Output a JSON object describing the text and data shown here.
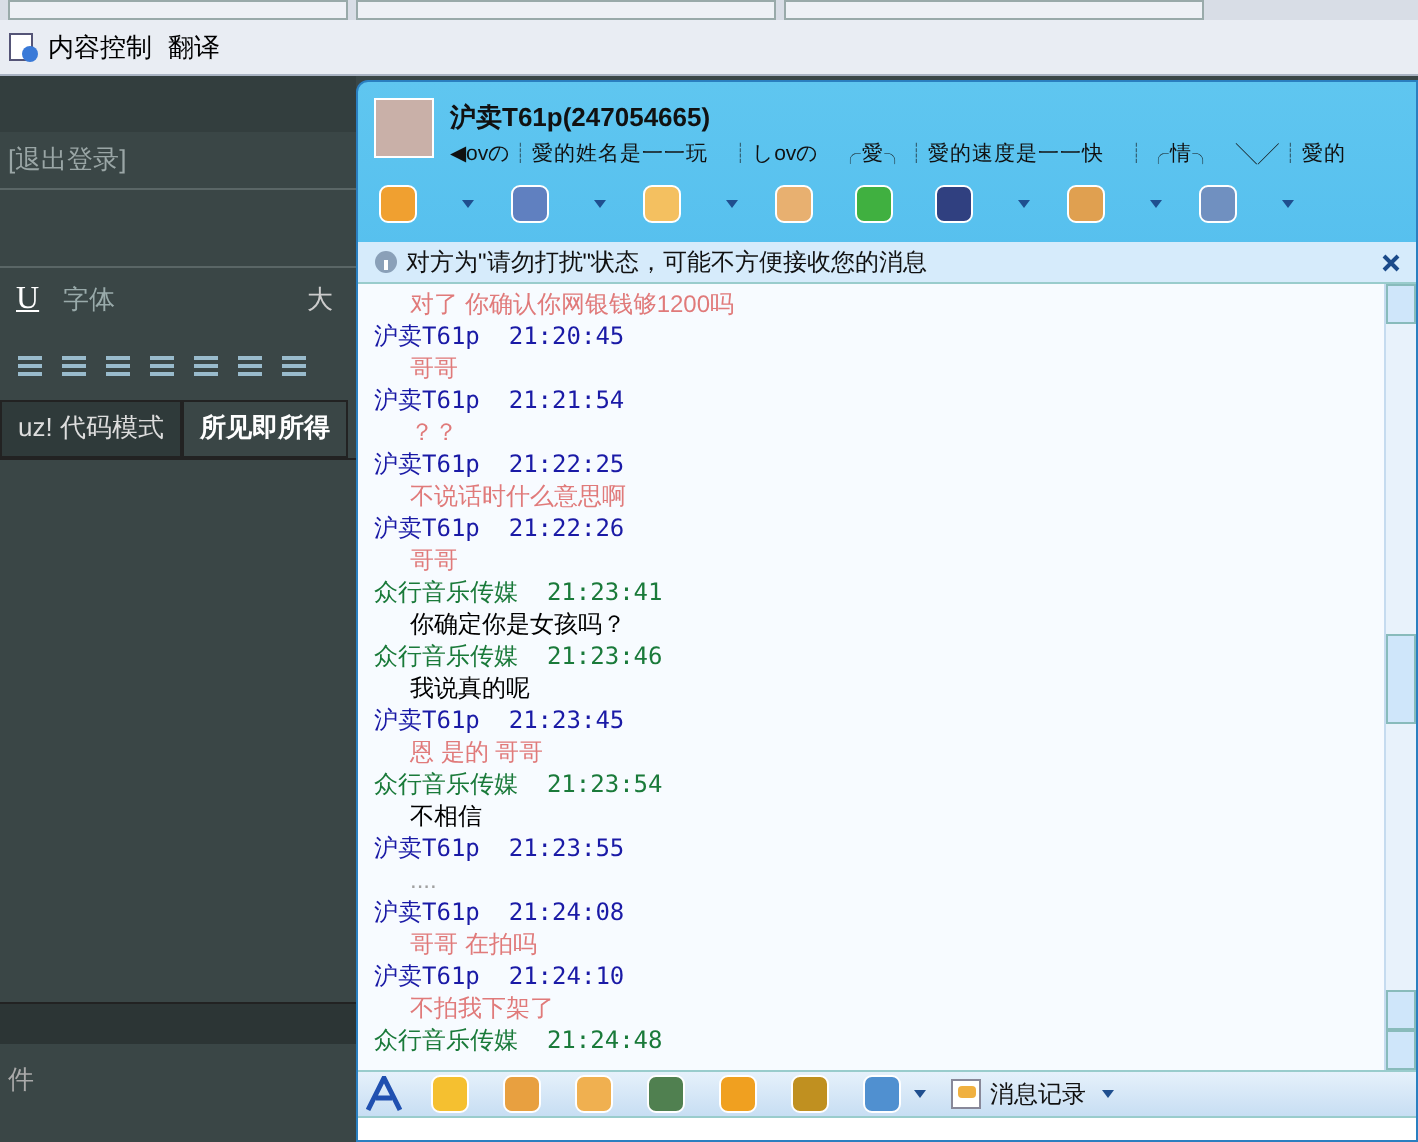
{
  "browser_toolbar": {
    "items": [
      "内容控制",
      "翻译"
    ]
  },
  "page": {
    "logout_link": "[退出登录]",
    "editor_toolbar": {
      "underline": "U",
      "font_select": "字体",
      "size_select": "大"
    },
    "editor_tabs": [
      {
        "label": "uz! 代码模式",
        "selected": false
      },
      {
        "label": "所见即所得",
        "selected": true
      }
    ],
    "attachment_label": "件"
  },
  "chat_window": {
    "title": "沪卖T61p(247054665)",
    "signature": "◀ovの┊愛的姓名是一一玩　┊しovの　╭愛╮┊愛的速度是一一快　┊╭情╮　╲╱┊愛的",
    "notice": "对方为\"请勿打扰\"状态，可能不方便接收您的消息",
    "messages": [
      {
        "text": "对了  你确认你网银钱够1200吗",
        "color": "#e07a7a"
      },
      {
        "kind": "contact",
        "sender": "沪卖T61p",
        "time": "21:20:45",
        "text": "哥哥",
        "color": "#e07a7a"
      },
      {
        "kind": "contact",
        "sender": "沪卖T61p",
        "time": "21:21:54",
        "text": "？？",
        "color": "#e07a7a"
      },
      {
        "kind": "contact",
        "sender": "沪卖T61p",
        "time": "21:22:25",
        "text": "不说话时什么意思啊",
        "color": "#e07a7a"
      },
      {
        "kind": "contact",
        "sender": "沪卖T61p",
        "time": "21:22:26",
        "text": "哥哥",
        "color": "#e07a7a"
      },
      {
        "kind": "self",
        "sender": "众行音乐传媒",
        "time": "21:23:41",
        "text": "你确定你是女孩吗？",
        "color": "#000000"
      },
      {
        "kind": "self",
        "sender": "众行音乐传媒",
        "time": "21:23:46",
        "text": "我说真的呢",
        "color": "#000000"
      },
      {
        "kind": "contact",
        "sender": "沪卖T61p",
        "time": "21:23:45",
        "text": "恩  是的  哥哥",
        "color": "#e07a7a"
      },
      {
        "kind": "self",
        "sender": "众行音乐传媒",
        "time": "21:23:54",
        "text": "不相信",
        "color": "#000000"
      },
      {
        "kind": "contact",
        "sender": "沪卖T61p",
        "time": "21:23:55",
        "text": "....",
        "color": "#a0a0a0"
      },
      {
        "kind": "contact",
        "sender": "沪卖T61p",
        "time": "21:24:08",
        "text": "哥哥  在拍吗",
        "color": "#e07a7a"
      },
      {
        "kind": "contact",
        "sender": "沪卖T61p",
        "time": "21:24:10",
        "text": "不拍我下架了",
        "color": "#e07a7a"
      },
      {
        "kind": "self",
        "sender": "众行音乐传媒",
        "time": "21:24:48"
      }
    ],
    "history_button": "消息记录"
  }
}
